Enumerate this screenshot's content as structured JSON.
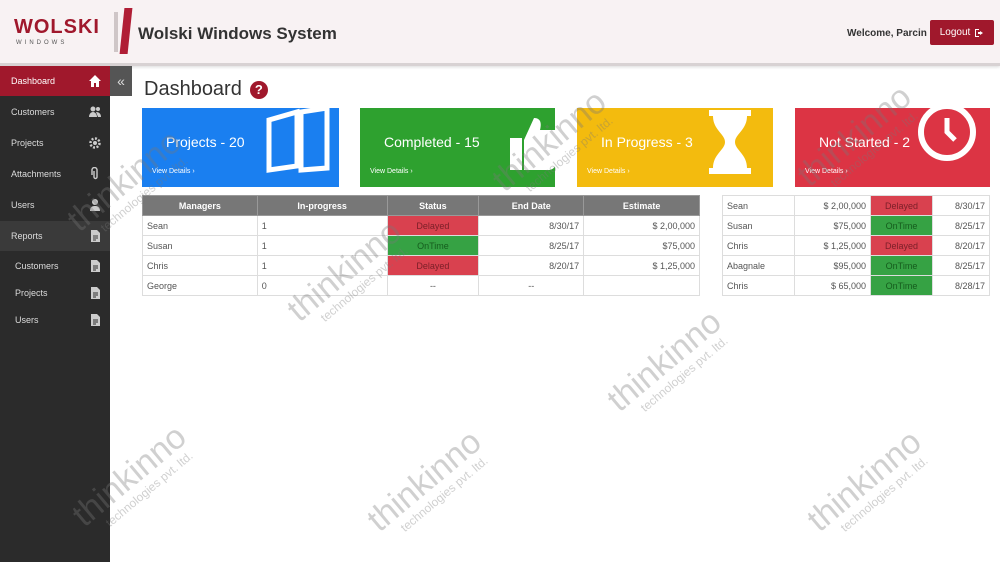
{
  "header": {
    "logo_text": "WOLSKI",
    "logo_sub": "WINDOWS",
    "title": "Wolski Windows System",
    "welcome": "Welcome, Parcin",
    "logout_label": "Logout"
  },
  "sidebar": {
    "items": [
      {
        "label": "Dashboard",
        "icon": "home-icon"
      },
      {
        "label": "Customers",
        "icon": "users-icon"
      },
      {
        "label": "Projects",
        "icon": "gear-icon"
      },
      {
        "label": "Attachments",
        "icon": "paperclip-icon"
      },
      {
        "label": "Users",
        "icon": "user-icon"
      },
      {
        "label": "Reports",
        "icon": "document-icon"
      },
      {
        "label": "Customers",
        "icon": "document-icon"
      },
      {
        "label": "Projects",
        "icon": "document-icon"
      },
      {
        "label": "Users",
        "icon": "document-icon"
      }
    ]
  },
  "main": {
    "title": "Dashboard",
    "cards": [
      {
        "title": "Projects - 20",
        "link": "View Details ›",
        "color": "#1a7ff0"
      },
      {
        "title": "Completed - 15",
        "link": "View Details ›",
        "color": "#2ea12f"
      },
      {
        "title": "In Progress - 3",
        "link": "View Details ›",
        "color": "#f3bb0e"
      },
      {
        "title": "Not Started - 2",
        "link": "View Details ›",
        "color": "#dc3444"
      }
    ],
    "managers_table": {
      "headers": [
        "Managers",
        "In-progress",
        "Status",
        "End Date",
        "Estimate"
      ],
      "rows": [
        [
          "Sean",
          "1",
          "Delayed",
          "8/30/17",
          "$ 2,00,000"
        ],
        [
          "Susan",
          "1",
          "OnTime",
          "8/25/17",
          "$75,000"
        ],
        [
          "Chris",
          "1",
          "Delayed",
          "8/20/17",
          "$ 1,25,000"
        ],
        [
          "George",
          "0",
          "--",
          "--",
          ""
        ]
      ]
    },
    "side_table": {
      "rows": [
        [
          "Sean",
          "$ 2,00,000",
          "Delayed",
          "8/30/17"
        ],
        [
          "Susan",
          "$75,000",
          "OnTime",
          "8/25/17"
        ],
        [
          "Chris",
          "$ 1,25,000",
          "Delayed",
          "8/20/17"
        ],
        [
          "Abagnale",
          "$95,000",
          "OnTime",
          "8/25/17"
        ],
        [
          "Chris",
          "$ 65,000",
          "OnTime",
          "8/28/17"
        ]
      ]
    }
  },
  "watermark": {
    "main": "thinkinno",
    "sub": "technologies pvt. ltd."
  },
  "colors": {
    "brand": "#a0182c",
    "delayed": "#d9414f",
    "ontime": "#36a244"
  }
}
